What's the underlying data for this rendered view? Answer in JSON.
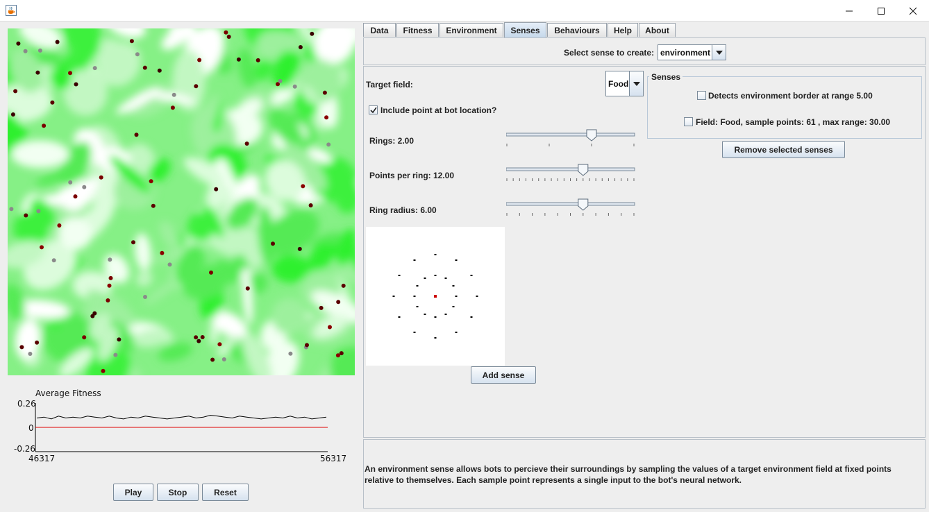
{
  "window": {
    "icons": {
      "app": "java-cup-icon",
      "minimize": "minimize-icon",
      "maximize": "maximize-icon",
      "close": "close-icon"
    }
  },
  "fitness_chart": {
    "chart_data": {
      "type": "line",
      "title": "Average Fitness",
      "ylim": [
        -0.26,
        0.26
      ],
      "yticks": [
        "0.26",
        "0",
        "-0.26"
      ],
      "xlim": [
        46317,
        56317
      ],
      "xticks": [
        "46317",
        "56317"
      ],
      "series": [
        {
          "values": [
            0.1,
            0.11,
            0.09,
            0.12,
            0.1,
            0.11,
            0.1,
            0.12,
            0.11,
            0.1,
            0.12,
            0.1,
            0.09,
            0.11,
            0.1,
            0.12,
            0.11,
            0.1,
            0.09,
            0.1,
            0.11,
            0.12,
            0.1,
            0.11,
            0.13,
            0.12,
            0.11,
            0.1,
            0.12,
            0.11,
            0.1,
            0.09,
            0.1,
            0.11,
            0.1,
            0.12,
            0.1,
            0.11,
            0.09,
            0.1,
            0.11
          ],
          "color": "#000000"
        },
        {
          "values": [
            0,
            0
          ],
          "color": "#e00000"
        }
      ]
    }
  },
  "controls": {
    "play": "Play",
    "stop": "Stop",
    "reset": "Reset"
  },
  "tabs": [
    {
      "label": "Data"
    },
    {
      "label": "Fitness"
    },
    {
      "label": "Environment"
    },
    {
      "label": "Senses",
      "selected": true
    },
    {
      "label": "Behaviours"
    },
    {
      "label": "Help"
    },
    {
      "label": "About"
    }
  ],
  "senses_tab": {
    "select_label": "Select sense to create:",
    "select_value": "environment",
    "target_field_label": "Target field:",
    "target_field_value": "Food",
    "include_point_label": "Include point at bot location?",
    "include_point_checked": true,
    "rings_label": "Rings: 2.00",
    "rings_value": 2.0,
    "rings_range": [
      0,
      3
    ],
    "points_label": "Points per ring: 12.00",
    "points_value": 12.0,
    "points_range": [
      0,
      20
    ],
    "radius_label": "Ring radius: 6.00",
    "radius_value": 6.0,
    "radius_range": [
      0,
      10
    ],
    "add_button": "Add sense",
    "senses_group_title": "Senses",
    "senses_list": [
      {
        "label": "Detects environment border at range 5.00",
        "checked": false
      },
      {
        "label": "Field: Food, sample points: 61 , max range: 30.00",
        "checked": false
      }
    ],
    "remove_button": "Remove selected senses",
    "description": "An environment sense allows bots to percieve their surroundings by sampling the values of a target environment field at fixed points relative to themselves. Each sample point represents a single input to the bot's neural network."
  }
}
